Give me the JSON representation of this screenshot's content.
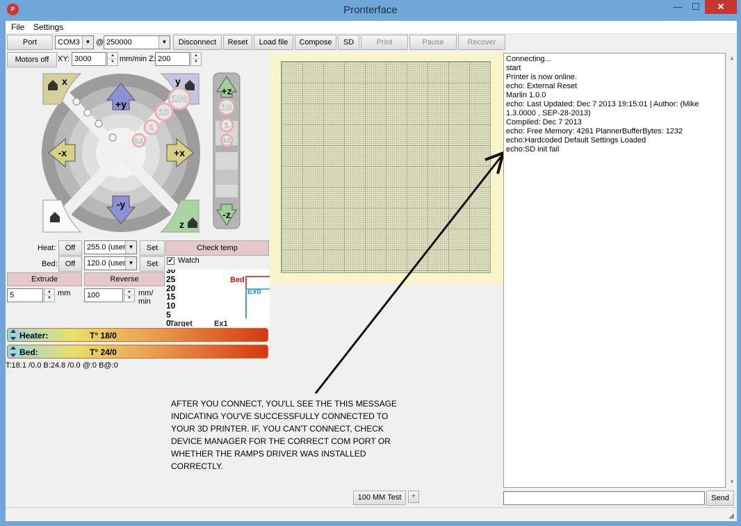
{
  "window": {
    "title": "Pronterface",
    "minimize": "—",
    "maximize": "☐",
    "close": "✕",
    "icon_text": "P"
  },
  "menu": {
    "file": "File",
    "settings": "Settings"
  },
  "toolbar": {
    "port": "Port",
    "com_port": "COM3",
    "at": "@",
    "baud": "250000",
    "disconnect": "Disconnect",
    "reset": "Reset",
    "load_file": "Load file",
    "compose": "Compose",
    "sd": "SD",
    "print": "Print",
    "pause": "Pause",
    "recover": "Recover"
  },
  "motion": {
    "motors_off": "Motors off",
    "xy_label": "XY:",
    "xy_value": "3000",
    "mm_min_z": "mm/min Z:",
    "z_value": "200",
    "plus_y": "+y",
    "minus_y": "-y",
    "plus_x": "+x",
    "minus_x": "-x",
    "home_x": "x",
    "home_y": "y",
    "home_z": "z",
    "steps": [
      "100",
      "10",
      "1",
      "0.1"
    ],
    "plus_z": "+z",
    "minus_z": "-z",
    "z_steps": [
      "10",
      "1",
      "0.1"
    ]
  },
  "temp": {
    "heat_label": "Heat:",
    "heat_off": "Off",
    "heat_value": "255.0 (user",
    "bed_label": "Bed:",
    "bed_off": "Off",
    "bed_value": "120.0 (user",
    "set": "Set",
    "check_temp": "Check temp",
    "watch": "Watch"
  },
  "extrude": {
    "extrude": "Extrude",
    "reverse": "Reverse",
    "amount": "5",
    "mm": "mm",
    "speed": "100",
    "mm_min_1": "mm/",
    "mm_min_2": "min"
  },
  "graph": {
    "y_ticks": [
      "30",
      "25",
      "20",
      "15",
      "10",
      "5",
      "0"
    ],
    "bed_label": "Bed",
    "ex_label": "Ex0",
    "target_label": "Target",
    "ex1_label": "Ex1"
  },
  "gauges": {
    "heater_name": "Heater:",
    "heater_value": "T° 18/0",
    "bed_name": "Bed:",
    "bed_value": "T° 24/0"
  },
  "status_line": "T:18.1 /0.0 B:24.8 /0.0 @:0 B@:0",
  "annotation": [
    "After you connect, you'll see the this message",
    "indicating you've successfully connected to",
    "your 3D printer.  If, you can't connect, check",
    "device manager for the correct COM port or",
    "whether the RAMPS driver was installed",
    "correctly."
  ],
  "log": [
    "Connecting...",
    "start",
    "Printer is now online.",
    "echo: External Reset",
    "Marlin 1.0.0",
    "echo: Last Updated: Dec  7 2013 19:15:01 | Author: (Mike",
    "1.3.0000 , SEP-28-2013)",
    "Compiled: Dec  7 2013",
    "echo: Free Memory: 4261  PlannerBufferBytes: 1232",
    "echo:Hardcoded Default Settings Loaded",
    "echo:SD init fail"
  ],
  "bottom": {
    "macro": "100 MM Test",
    "add": "+",
    "send": "Send",
    "command": ""
  }
}
